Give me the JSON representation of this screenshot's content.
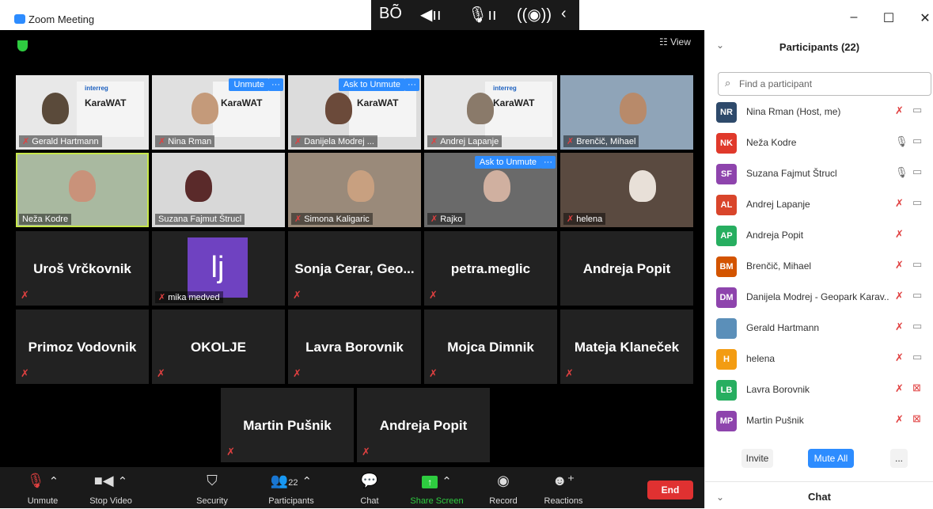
{
  "window": {
    "title": "Zoom Meeting",
    "minimize": "–",
    "maximize": "☐",
    "close": "✕"
  },
  "floatbar": {
    "icons": [
      "BÕ",
      "◀ıı",
      "🎙ıı",
      "((◉))",
      "‹"
    ]
  },
  "meeting": {
    "view_label": "☷ View"
  },
  "video_tiles": [
    {
      "name": "Gerald Hartmann",
      "muted": true,
      "slide": true
    },
    {
      "name": "Nina Rman",
      "muted": false,
      "ask": "Unmute",
      "slide": true
    },
    {
      "name": "Danijela Modrej ...",
      "muted": true,
      "ask": "Ask to Unmute"
    },
    {
      "name": "Andrej Lapanje",
      "muted": true,
      "slide": true
    },
    {
      "name": "Brenčič, Mihael",
      "muted": true
    },
    {
      "name": "Neža Kodre",
      "muted": false,
      "highlight": true
    },
    {
      "name": "Suzana Fajmut Štrucl",
      "muted": false
    },
    {
      "name": "Simona Kaligaric",
      "muted": true
    },
    {
      "name": "Rajko",
      "muted": true,
      "ask": "Ask to Unmute"
    },
    {
      "name": "helena",
      "muted": true
    }
  ],
  "slide_text": {
    "brand": "interreg",
    "title": "KaraWAT"
  },
  "name_tiles": [
    {
      "name": "Uroš Vrčkovnik"
    },
    {
      "name": "mika medved",
      "avatar": "lj"
    },
    {
      "name": "Sonja Cerar, Geo..."
    },
    {
      "name": "petra.meglic"
    },
    {
      "name": "Andreja Popit"
    },
    {
      "name": "Primoz Vodovnik"
    },
    {
      "name": "OKOLJE"
    },
    {
      "name": "Lavra Borovnik"
    },
    {
      "name": "Mojca Dimnik"
    },
    {
      "name": "Mateja Klaneček"
    },
    {
      "name": "Martin Pušnik"
    },
    {
      "name": "Andreja Popit"
    }
  ],
  "toolbar": {
    "unmute": "Unmute",
    "stop_video": "Stop Video",
    "security": "Security",
    "participants": "Participants",
    "participants_count": "22",
    "chat": "Chat",
    "share": "Share Screen",
    "record": "Record",
    "reactions": "Reactions",
    "end": "End"
  },
  "panel": {
    "title": "Participants (22)",
    "search_placeholder": "Find a participant",
    "participants": [
      {
        "initials": "NR",
        "name": "Nina Rman (Host, me)",
        "color": "#2e4a6b",
        "mic": "off",
        "cam": "on"
      },
      {
        "initials": "NK",
        "name": "Neža Kodre",
        "color": "#e0392b",
        "mic": "on",
        "cam": "on"
      },
      {
        "initials": "SF",
        "name": "Suzana Fajmut Štrucl",
        "color": "#8e44ad",
        "mic": "on",
        "cam": "on"
      },
      {
        "initials": "AL",
        "name": "Andrej Lapanje",
        "color": "#d9452b",
        "mic": "off",
        "cam": "on"
      },
      {
        "initials": "AP",
        "name": "Andreja Popit",
        "color": "#27ae60",
        "mic": "off",
        "cam": "none"
      },
      {
        "initials": "BM",
        "name": "Brenčič, Mihael",
        "color": "#d35400",
        "mic": "off",
        "cam": "on"
      },
      {
        "initials": "DM",
        "name": "Danijela Modrej - Geopark Karav...",
        "color": "#8e44ad",
        "mic": "off",
        "cam": "on"
      },
      {
        "initials": "",
        "name": "Gerald Hartmann",
        "color": "#5b8fb9",
        "mic": "off",
        "cam": "on"
      },
      {
        "initials": "H",
        "name": "helena",
        "color": "#f39c12",
        "mic": "off",
        "cam": "on"
      },
      {
        "initials": "LB",
        "name": "Lavra Borovnik",
        "color": "#27ae60",
        "mic": "off",
        "cam": "off"
      },
      {
        "initials": "MP",
        "name": "Martin Pušnik",
        "color": "#8e44ad",
        "mic": "off",
        "cam": "off"
      }
    ],
    "invite": "Invite",
    "mute_all": "Mute All",
    "more": "...",
    "chat_title": "Chat"
  }
}
